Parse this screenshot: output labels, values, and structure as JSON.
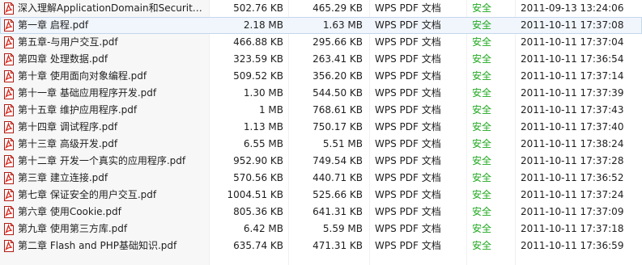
{
  "file_list": {
    "icon": "pdf-file-icon",
    "accent_color": "#d42a1e",
    "security_color": "#1fa81f",
    "selected_row_index": 1,
    "rows": [
      {
        "name": "深入理解ApplicationDomain和Security...",
        "size": "502.76 KB",
        "compressed": "465.29 KB",
        "type": "WPS PDF 文档",
        "security": "安全",
        "modified": "2011-09-13 13:24:06"
      },
      {
        "name": "第一章 启程.pdf",
        "size": "2.18 MB",
        "compressed": "1.63 MB",
        "type": "WPS PDF 文档",
        "security": "安全",
        "modified": "2011-10-11 17:37:08"
      },
      {
        "name": "第五章-与用户交互.pdf",
        "size": "466.88 KB",
        "compressed": "295.66 KB",
        "type": "WPS PDF 文档",
        "security": "安全",
        "modified": "2011-10-11 17:37:04"
      },
      {
        "name": "第四章 处理数据.pdf",
        "size": "323.59 KB",
        "compressed": "263.41 KB",
        "type": "WPS PDF 文档",
        "security": "安全",
        "modified": "2011-10-11 17:36:54"
      },
      {
        "name": "第十章 使用面向对象编程.pdf",
        "size": "509.52 KB",
        "compressed": "356.20 KB",
        "type": "WPS PDF 文档",
        "security": "安全",
        "modified": "2011-10-11 17:37:14"
      },
      {
        "name": "第十一章 基础应用程序开发.pdf",
        "size": "1.30 MB",
        "compressed": "544.50 KB",
        "type": "WPS PDF 文档",
        "security": "安全",
        "modified": "2011-10-11 17:37:39"
      },
      {
        "name": "第十五章 维护应用程序.pdf",
        "size": "1 MB",
        "compressed": "768.61 KB",
        "type": "WPS PDF 文档",
        "security": "安全",
        "modified": "2011-10-11 17:37:43"
      },
      {
        "name": "第十四章 调试程序.pdf",
        "size": "1.13 MB",
        "compressed": "750.17 KB",
        "type": "WPS PDF 文档",
        "security": "安全",
        "modified": "2011-10-11 17:37:40"
      },
      {
        "name": "第十三章 高级开发.pdf",
        "size": "6.55 MB",
        "compressed": "5.51 MB",
        "type": "WPS PDF 文档",
        "security": "安全",
        "modified": "2011-10-11 17:38:24"
      },
      {
        "name": "第十二章 开发一个真实的应用程序.pdf",
        "size": "952.90 KB",
        "compressed": "749.54 KB",
        "type": "WPS PDF 文档",
        "security": "安全",
        "modified": "2011-10-11 17:37:28"
      },
      {
        "name": "第三章  建立连接.pdf",
        "size": "570.56 KB",
        "compressed": "440.71 KB",
        "type": "WPS PDF 文档",
        "security": "安全",
        "modified": "2011-10-11 17:36:52"
      },
      {
        "name": "第七章 保证安全的用户交互.pdf",
        "size": "1004.51 KB",
        "compressed": "525.66 KB",
        "type": "WPS PDF 文档",
        "security": "安全",
        "modified": "2011-10-11 17:37:24"
      },
      {
        "name": "第六章 使用Cookie.pdf",
        "size": "805.36 KB",
        "compressed": "641.31 KB",
        "type": "WPS PDF 文档",
        "security": "安全",
        "modified": "2011-10-11 17:37:09"
      },
      {
        "name": "第九章 使用第三方库.pdf",
        "size": "6.42 MB",
        "compressed": "5.59 MB",
        "type": "WPS PDF 文档",
        "security": "安全",
        "modified": "2011-10-11 17:37:18"
      },
      {
        "name": "第二章 Flash and PHP基础知识.pdf",
        "size": "635.74 KB",
        "compressed": "471.31 KB",
        "type": "WPS PDF 文档",
        "security": "安全",
        "modified": "2011-10-11 17:36:59"
      }
    ]
  }
}
